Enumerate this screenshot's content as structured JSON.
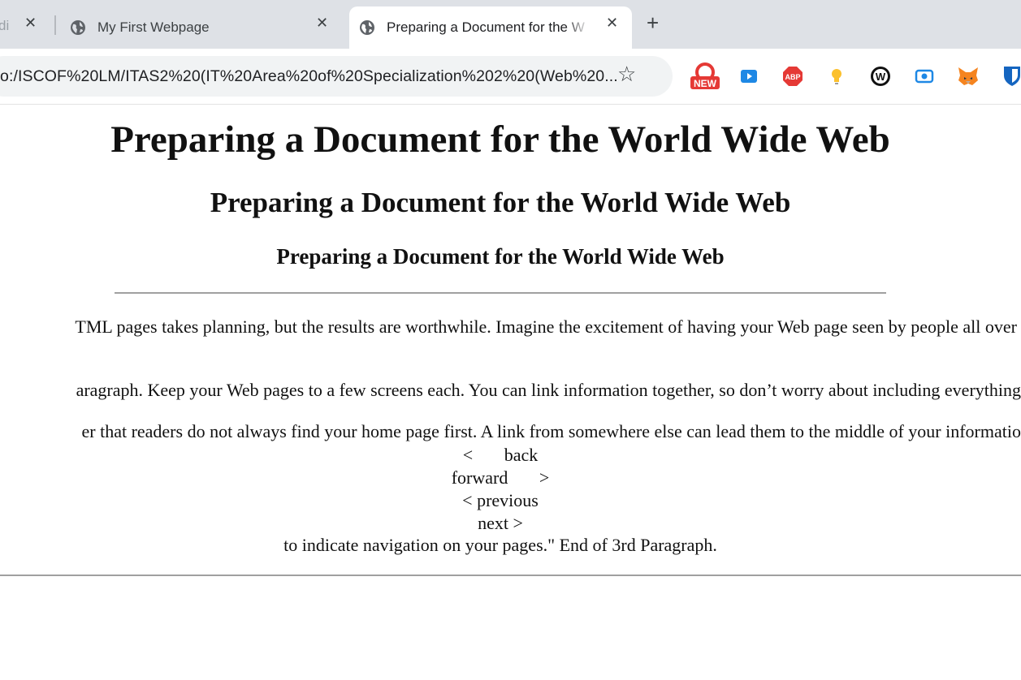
{
  "browser": {
    "tabs": [
      {
        "title": "di",
        "active": false
      },
      {
        "title": "My First Webpage",
        "active": false
      },
      {
        "title": "Preparing a Document for the W",
        "active": true
      }
    ],
    "new_tab_label": "+",
    "close_label": "✕",
    "address_bar": {
      "url": "o:/ISCOF%20LM/ITAS2%20(IT%20Area%20of%20Specialization%202%20(Web%20..."
    },
    "bookmark_icon": "star-icon",
    "extensions": [
      {
        "name": "new-badge-extension-icon",
        "label": "NEW",
        "color": "#e53935"
      },
      {
        "name": "video-extension-icon",
        "color": "#1e88e5"
      },
      {
        "name": "adblock-plus-icon",
        "label": "ABP",
        "color": "#e53935"
      },
      {
        "name": "lightbulb-extension-icon",
        "color": "#fbc02d"
      },
      {
        "name": "w-extension-icon",
        "label": "W",
        "color": "#111111"
      },
      {
        "name": "screen-record-extension-icon",
        "color": "#1e88e5"
      },
      {
        "name": "metamask-fox-icon",
        "color": "#f5841f"
      },
      {
        "name": "bitwarden-shield-icon",
        "color": "#1565c0"
      }
    ]
  },
  "page": {
    "h1": "Preparing a Document for the World Wide Web",
    "h2": "Preparing a Document for the World Wide Web",
    "h3": "Preparing a Document for the World Wide Web",
    "paragraphs": [
      "TML pages takes planning, but the results are worthwhile. Imagine the excitement of having your Web page seen by people all over",
      "aragraph. Keep your Web pages to a few screens each. You can link information together, so don’t worry about including everything",
      "er that readers do not always find your home page first. A link from somewhere else can lead them to the middle of your informatio"
    ],
    "nav_lines": [
      "<       back",
      "forward       >",
      "< previous",
      "next >",
      "to indicate navigation on your pages.\" End of 3rd Paragraph."
    ]
  }
}
